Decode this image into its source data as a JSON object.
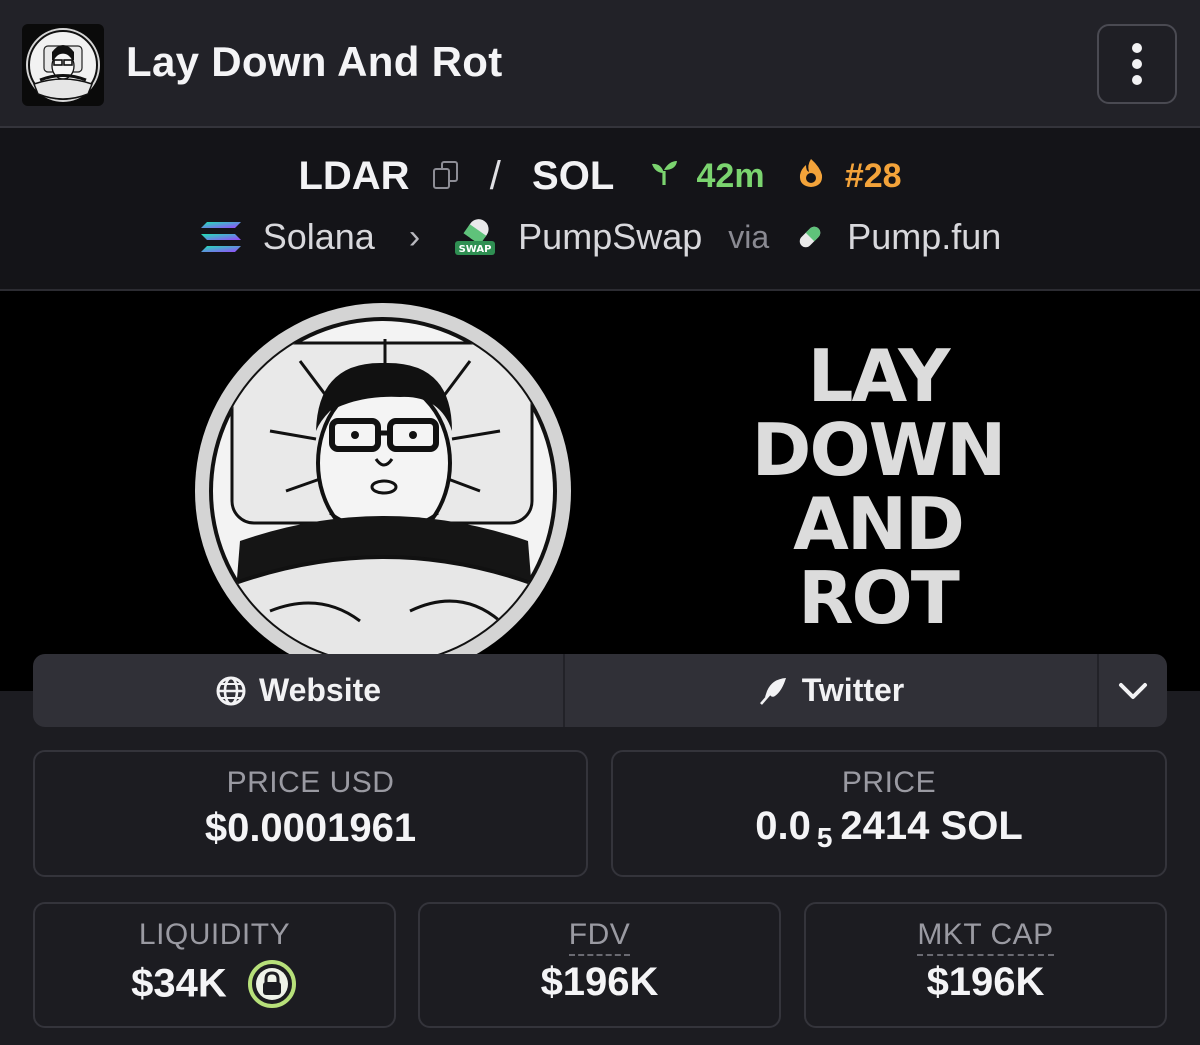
{
  "header": {
    "title": "Lay Down And Rot",
    "avatar_icon": "token-avatar-icon",
    "menu_icon": "more-vertical-icon"
  },
  "pair": {
    "base": "LDAR",
    "separator": "/",
    "quote": "SOL",
    "age": "42m",
    "rank": "#28",
    "age_color": "#7bd46f",
    "rank_color": "#f3a33a"
  },
  "chain": {
    "name": "Solana",
    "dex": "PumpSwap",
    "dex_badge": "SWAP",
    "via": "via",
    "launchpad": "Pump.fun"
  },
  "banner": {
    "words": [
      "LAY",
      "DOWN",
      "AND",
      "ROT"
    ]
  },
  "links": {
    "website": "Website",
    "twitter": "Twitter"
  },
  "stats": {
    "price_usd_label": "PRICE USD",
    "price_usd": "$0.0001961",
    "price_label": "PRICE",
    "price_prefix": "0.0",
    "price_zeros": "5",
    "price_digits": "2414 SOL",
    "liquidity_label": "LIQUIDITY",
    "liquidity": "$34K",
    "fdv_label": "FDV",
    "fdv": "$196K",
    "mktcap_label": "MKT CAP",
    "mktcap": "$196K"
  }
}
